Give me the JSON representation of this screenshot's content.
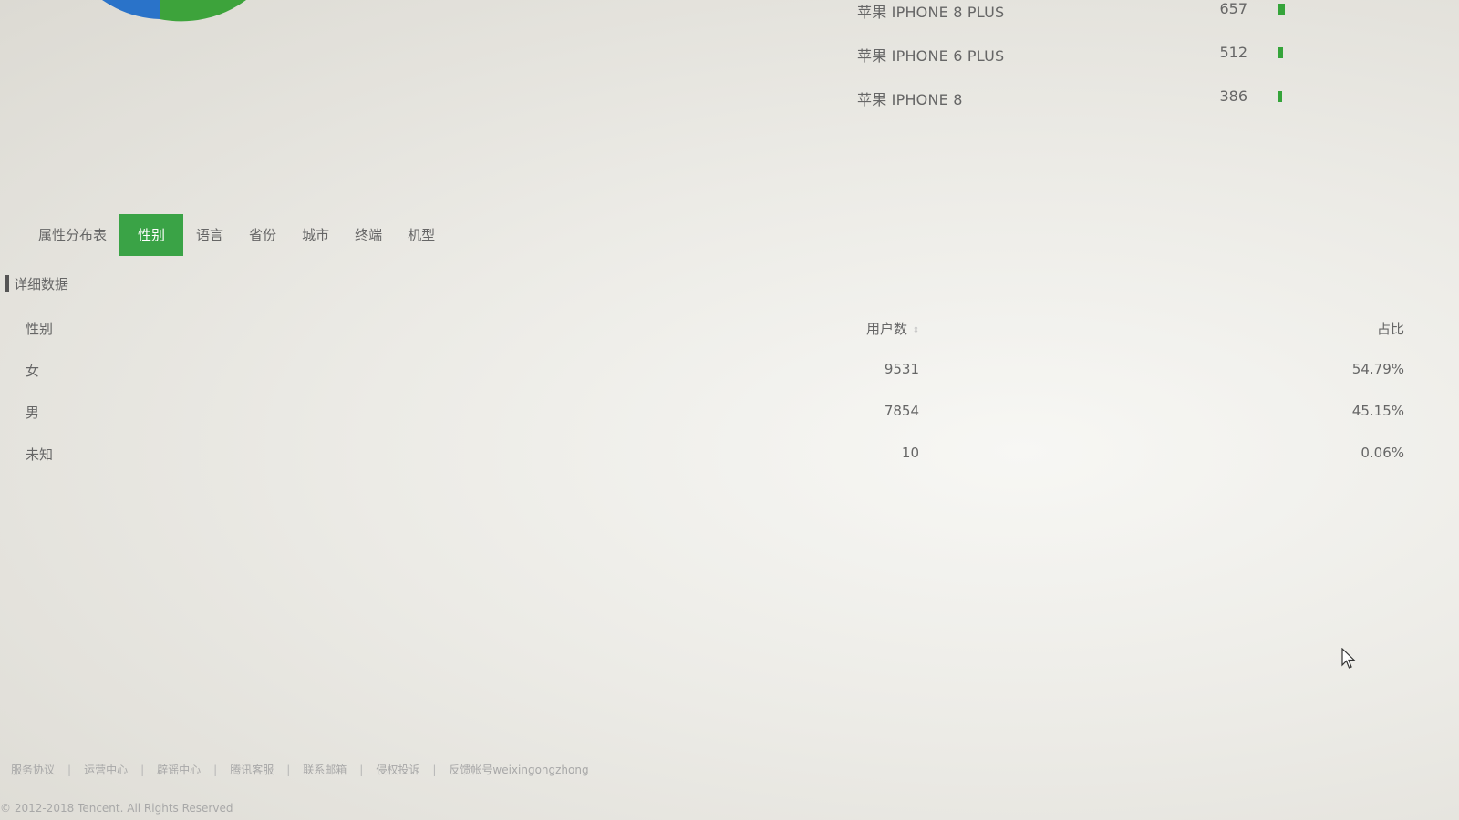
{
  "device_rank": [
    {
      "name": "苹果 IPHONE 8 PLUS",
      "count": "657",
      "bar_value": 657
    },
    {
      "name": "苹果 IPHONE 6 PLUS",
      "count": "512",
      "bar_value": 512
    },
    {
      "name": "苹果 IPHONE 8",
      "count": "386",
      "bar_value": 386
    }
  ],
  "tabs": [
    {
      "label": "属性分布表",
      "active": false
    },
    {
      "label": "性别",
      "active": true
    },
    {
      "label": "语言",
      "active": false
    },
    {
      "label": "省份",
      "active": false
    },
    {
      "label": "城市",
      "active": false
    },
    {
      "label": "终端",
      "active": false
    },
    {
      "label": "机型",
      "active": false
    }
  ],
  "section": {
    "title": "详细数据"
  },
  "table": {
    "headers": {
      "gender": "性别",
      "users": "用户数",
      "share": "占比"
    },
    "rows": [
      {
        "gender": "女",
        "users": "9531",
        "share": "54.79%"
      },
      {
        "gender": "男",
        "users": "7854",
        "share": "45.15%"
      },
      {
        "gender": "未知",
        "users": "10",
        "share": "0.06%"
      }
    ]
  },
  "footer": {
    "links": [
      "服务协议",
      "运营中心",
      "辟谣中心",
      "腾讯客服",
      "联系邮箱",
      "侵权投诉",
      "反馈帐号weixingongzhong"
    ],
    "separator": "|",
    "copyright": "© 2012-2018 Tencent. All Rights Reserved"
  },
  "colors": {
    "accent": "#3aa346",
    "bar": "#35a43a",
    "pie_blue": "#2a73c9",
    "pie_green": "#3da33b"
  },
  "icons": {
    "sort": "sort-icon",
    "cursor": "mouse-cursor-icon"
  }
}
